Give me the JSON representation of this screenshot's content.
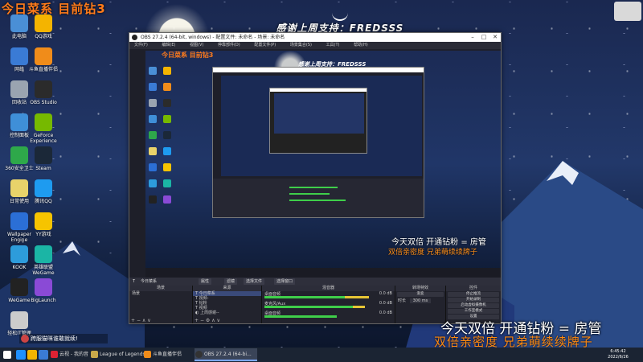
{
  "stream": {
    "top_title": "今日菜系  目前钻3",
    "banner": "感谢上周支持：FREDSSS",
    "overlay_line1": "今天双倍  开通钻粉 = 房管",
    "overlay_line2": "双倍亲密度  兄弟萌续续牌子",
    "bottom_pill": "跨服猫咪谁敢就续!"
  },
  "desktop_icons": [
    {
      "label": "此电脑",
      "color": "#4a8fd6"
    },
    {
      "label": "QQ游戏",
      "color": "#f4b400"
    },
    {
      "label": "网络",
      "color": "#3a7bd5"
    },
    {
      "label": "斗鱼直播伴侣",
      "color": "#f08c1a"
    },
    {
      "label": "回收站",
      "color": "#9aa4b0"
    },
    {
      "label": "OBS Studio",
      "color": "#2b2b2b"
    },
    {
      "label": "控制面板",
      "color": "#3f8fd8"
    },
    {
      "label": "GeForce Experience",
      "color": "#76b900"
    },
    {
      "label": "360安全卫士",
      "color": "#2ea84a"
    },
    {
      "label": "Steam",
      "color": "#1b2838"
    },
    {
      "label": "日常使用",
      "color": "#e8d36a"
    },
    {
      "label": "腾讯QQ",
      "color": "#1e9bf0"
    },
    {
      "label": "Wallpaper Engine",
      "color": "#2b6fd6"
    },
    {
      "label": "YY游戏",
      "color": "#f6c400"
    },
    {
      "label": "KOOK",
      "color": "#2d9cdb"
    },
    {
      "label": "英雄联盟WeGame",
      "color": "#1bb5a5"
    },
    {
      "label": "WeGame",
      "color": "#222222"
    },
    {
      "label": "BigLaunch",
      "color": "#8a4ad6"
    },
    {
      "label": "轻松IT管理",
      "color": "#cccccc"
    }
  ],
  "obs": {
    "title": "OBS 27.2.4 (64-bit, windows) - 配置文件: 未命名 - 场景: 未命名",
    "menu": [
      "文件(F)",
      "编辑(E)",
      "视图(V)",
      "停靠部件(D)",
      "配置文件(P)",
      "场景集合(S)",
      "工具(T)",
      "帮助(H)"
    ],
    "current_scene_label": "今日菜系",
    "toolbar_buttons": [
      "属性",
      "滤镜",
      "选择文件",
      "选择窗口"
    ],
    "docks": {
      "scenes": {
        "header": "场景",
        "items": [
          "场景"
        ]
      },
      "sources": {
        "header": "来源",
        "items": [
          "今日菜系",
          "视频-",
          "钻粉",
          "视频",
          "视频-",
          "上周感谢--"
        ]
      },
      "mixer": {
        "header": "混音器",
        "tracks": [
          {
            "name": "桌面音频",
            "db": "0.0 dB"
          },
          {
            "name": "麦克风/Aux",
            "db": "0.0 dB"
          },
          {
            "name": "桌面音频",
            "db": "0.0 dB"
          }
        ]
      },
      "transitions": {
        "header": "转场特效",
        "type": "渐变",
        "duration_label": "时长",
        "duration": "300 ms"
      },
      "controls": {
        "header": "控件",
        "buttons": [
          "停止推流",
          "开始录制",
          "启动虚拟摄像机",
          "工作室模式",
          "设置",
          "退出"
        ]
      }
    },
    "status": "LIVE: 00:00:00   REC: 00:00:00   CPU: 2.1%, 60.00 fps"
  },
  "taskbar": {
    "items": [
      {
        "label": "",
        "color": "#1e90ff"
      },
      {
        "label": "",
        "color": "#f4b400"
      },
      {
        "label": "",
        "color": "#3a7bd5"
      },
      {
        "label": "",
        "color": "#2ea84a"
      }
    ],
    "apps": [
      {
        "label": "云视 - 我的音乐...",
        "color": "#d23"
      },
      {
        "label": "League of Legends",
        "color": "#c8a94a"
      },
      {
        "label": "斗鱼直播伴侣",
        "color": "#f08c1a"
      },
      {
        "label": "OBS 27.2.4 (64-bi...",
        "color": "#333",
        "active": true
      }
    ],
    "time": "6:45:42",
    "date": "2022/6/26"
  },
  "colors": {
    "accent_orange": "#ff7b1a",
    "meter_green": "#3fcf4a",
    "obs_bg": "#1e1f29"
  }
}
